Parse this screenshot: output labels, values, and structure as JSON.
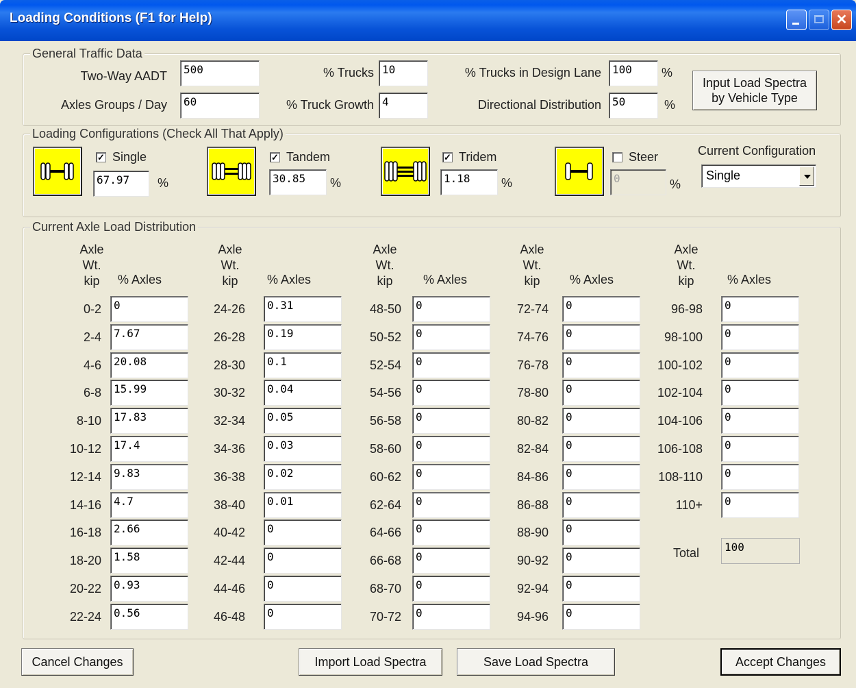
{
  "window": {
    "title": "Loading Conditions (F1 for Help)"
  },
  "traffic": {
    "group_label": "General Traffic Data",
    "aadt_label": "Two-Way AADT",
    "aadt": "500",
    "axles_label": "Axles Groups / Day",
    "axles": "60",
    "trucks_label": "% Trucks",
    "trucks": "10",
    "growth_label": "% Truck Growth",
    "growth": "4",
    "design_lane_label": "% Trucks in Design Lane",
    "design_lane": "100",
    "directional_label": "Directional Distribution",
    "directional": "50",
    "percent": "%",
    "spectra_button": "Input Load Spectra by Vehicle Type"
  },
  "config": {
    "group_label": "Loading Configurations (Check All That Apply)",
    "single": {
      "label": "Single",
      "checked": true,
      "value": "67.97"
    },
    "tandem": {
      "label": "Tandem",
      "checked": true,
      "value": "30.85"
    },
    "tridem": {
      "label": "Tridem",
      "checked": true,
      "value": "1.18"
    },
    "steer": {
      "label": "Steer",
      "checked": false,
      "value": "0"
    },
    "percent": "%",
    "current_label": "Current Configuration",
    "current_value": "Single",
    "check_glyph": "✓"
  },
  "distribution": {
    "group_label": "Current Axle Load Distribution",
    "head_axle": "Axle",
    "head_wt": "Wt.",
    "head_kip": "kip",
    "head_pct": "% Axles",
    "columns": [
      [
        {
          "range": "0-2",
          "value": "0"
        },
        {
          "range": "2-4",
          "value": "7.67"
        },
        {
          "range": "4-6",
          "value": "20.08"
        },
        {
          "range": "6-8",
          "value": "15.99"
        },
        {
          "range": "8-10",
          "value": "17.83"
        },
        {
          "range": "10-12",
          "value": "17.4"
        },
        {
          "range": "12-14",
          "value": "9.83"
        },
        {
          "range": "14-16",
          "value": "4.7"
        },
        {
          "range": "16-18",
          "value": "2.66"
        },
        {
          "range": "18-20",
          "value": "1.58"
        },
        {
          "range": "20-22",
          "value": "0.93"
        },
        {
          "range": "22-24",
          "value": "0.56"
        }
      ],
      [
        {
          "range": "24-26",
          "value": "0.31"
        },
        {
          "range": "26-28",
          "value": "0.19"
        },
        {
          "range": "28-30",
          "value": "0.1"
        },
        {
          "range": "30-32",
          "value": "0.04"
        },
        {
          "range": "32-34",
          "value": "0.05"
        },
        {
          "range": "34-36",
          "value": "0.03"
        },
        {
          "range": "36-38",
          "value": "0.02"
        },
        {
          "range": "38-40",
          "value": "0.01"
        },
        {
          "range": "40-42",
          "value": "0"
        },
        {
          "range": "42-44",
          "value": "0"
        },
        {
          "range": "44-46",
          "value": "0"
        },
        {
          "range": "46-48",
          "value": "0"
        }
      ],
      [
        {
          "range": "48-50",
          "value": "0"
        },
        {
          "range": "50-52",
          "value": "0"
        },
        {
          "range": "52-54",
          "value": "0"
        },
        {
          "range": "54-56",
          "value": "0"
        },
        {
          "range": "56-58",
          "value": "0"
        },
        {
          "range": "58-60",
          "value": "0"
        },
        {
          "range": "60-62",
          "value": "0"
        },
        {
          "range": "62-64",
          "value": "0"
        },
        {
          "range": "64-66",
          "value": "0"
        },
        {
          "range": "66-68",
          "value": "0"
        },
        {
          "range": "68-70",
          "value": "0"
        },
        {
          "range": "70-72",
          "value": "0"
        }
      ],
      [
        {
          "range": "72-74",
          "value": "0"
        },
        {
          "range": "74-76",
          "value": "0"
        },
        {
          "range": "76-78",
          "value": "0"
        },
        {
          "range": "78-80",
          "value": "0"
        },
        {
          "range": "80-82",
          "value": "0"
        },
        {
          "range": "82-84",
          "value": "0"
        },
        {
          "range": "84-86",
          "value": "0"
        },
        {
          "range": "86-88",
          "value": "0"
        },
        {
          "range": "88-90",
          "value": "0"
        },
        {
          "range": "90-92",
          "value": "0"
        },
        {
          "range": "92-94",
          "value": "0"
        },
        {
          "range": "94-96",
          "value": "0"
        }
      ],
      [
        {
          "range": "96-98",
          "value": "0"
        },
        {
          "range": "98-100",
          "value": "0"
        },
        {
          "range": "100-102",
          "value": "0"
        },
        {
          "range": "102-104",
          "value": "0"
        },
        {
          "range": "104-106",
          "value": "0"
        },
        {
          "range": "106-108",
          "value": "0"
        },
        {
          "range": "108-110",
          "value": "0"
        },
        {
          "range": "110+",
          "value": "0"
        }
      ]
    ],
    "total_label": "Total",
    "total": "100"
  },
  "buttons": {
    "cancel": "Cancel Changes",
    "import": "Import Load Spectra",
    "save": "Save Load Spectra",
    "accept": "Accept Changes"
  }
}
